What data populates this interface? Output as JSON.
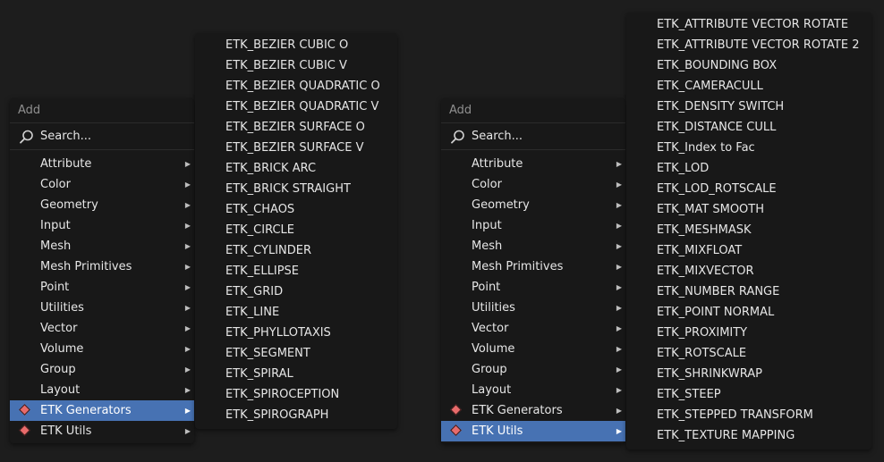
{
  "menu_left": {
    "title": "Add",
    "search_placeholder": "Search...",
    "items": [
      {
        "label": "Attribute"
      },
      {
        "label": "Color"
      },
      {
        "label": "Geometry"
      },
      {
        "label": "Input"
      },
      {
        "label": "Mesh"
      },
      {
        "label": "Mesh Primitives"
      },
      {
        "label": "Point"
      },
      {
        "label": "Utilities"
      },
      {
        "label": "Vector"
      },
      {
        "label": "Volume"
      },
      {
        "label": "Group"
      },
      {
        "label": "Layout"
      },
      {
        "label": "ETK Generators"
      },
      {
        "label": "ETK Utils"
      }
    ]
  },
  "menu_right": {
    "title": "Add",
    "search_placeholder": "Search...",
    "items": [
      {
        "label": "Attribute"
      },
      {
        "label": "Color"
      },
      {
        "label": "Geometry"
      },
      {
        "label": "Input"
      },
      {
        "label": "Mesh"
      },
      {
        "label": "Mesh Primitives"
      },
      {
        "label": "Point"
      },
      {
        "label": "Utilities"
      },
      {
        "label": "Vector"
      },
      {
        "label": "Volume"
      },
      {
        "label": "Group"
      },
      {
        "label": "Layout"
      },
      {
        "label": "ETK Generators"
      },
      {
        "label": "ETK Utils"
      }
    ]
  },
  "submenu_generators": {
    "items": [
      "ETK_BEZIER CUBIC O",
      "ETK_BEZIER CUBIC V",
      "ETK_BEZIER QUADRATIC O",
      "ETK_BEZIER QUADRATIC V",
      "ETK_BEZIER SURFACE O",
      "ETK_BEZIER SURFACE V",
      "ETK_BRICK ARC",
      "ETK_BRICK STRAIGHT",
      "ETK_CHAOS",
      "ETK_CIRCLE",
      "ETK_CYLINDER",
      "ETK_ELLIPSE",
      "ETK_GRID",
      "ETK_LINE",
      "ETK_PHYLLOTAXIS",
      "ETK_SEGMENT",
      "ETK_SPIRAL",
      "ETK_SPIROCEPTION",
      "ETK_SPIROGRAPH"
    ]
  },
  "submenu_utils": {
    "items": [
      "ETK_ATTRIBUTE VECTOR ROTATE",
      "ETK_ATTRIBUTE VECTOR ROTATE 2",
      "ETK_BOUNDING BOX",
      "ETK_CAMERACULL",
      "ETK_DENSITY SWITCH",
      "ETK_DISTANCE CULL",
      "ETK_Index to Fac",
      "ETK_LOD",
      "ETK_LOD_ROTSCALE",
      "ETK_MAT SMOOTH",
      "ETK_MESHMASK",
      "ETK_MIXFLOAT",
      "ETK_MIXVECTOR",
      "ETK_NUMBER RANGE",
      "ETK_POINT NORMAL",
      "ETK_PROXIMITY",
      "ETK_ROTSCALE",
      "ETK_SHRINKWRAP",
      "ETK_STEEP",
      "ETK_STEPPED TRANSFORM",
      "ETK_TEXTURE MAPPING"
    ]
  },
  "icons": {
    "search": "search-icon",
    "submenu_arrow": "submenu-arrow-icon",
    "node_group": "node-group-icon"
  },
  "colors": {
    "background": "#1d1d1d",
    "menu_bg": "#181818",
    "highlight": "#4772b3",
    "node_group_icon": "#e86b6b"
  }
}
